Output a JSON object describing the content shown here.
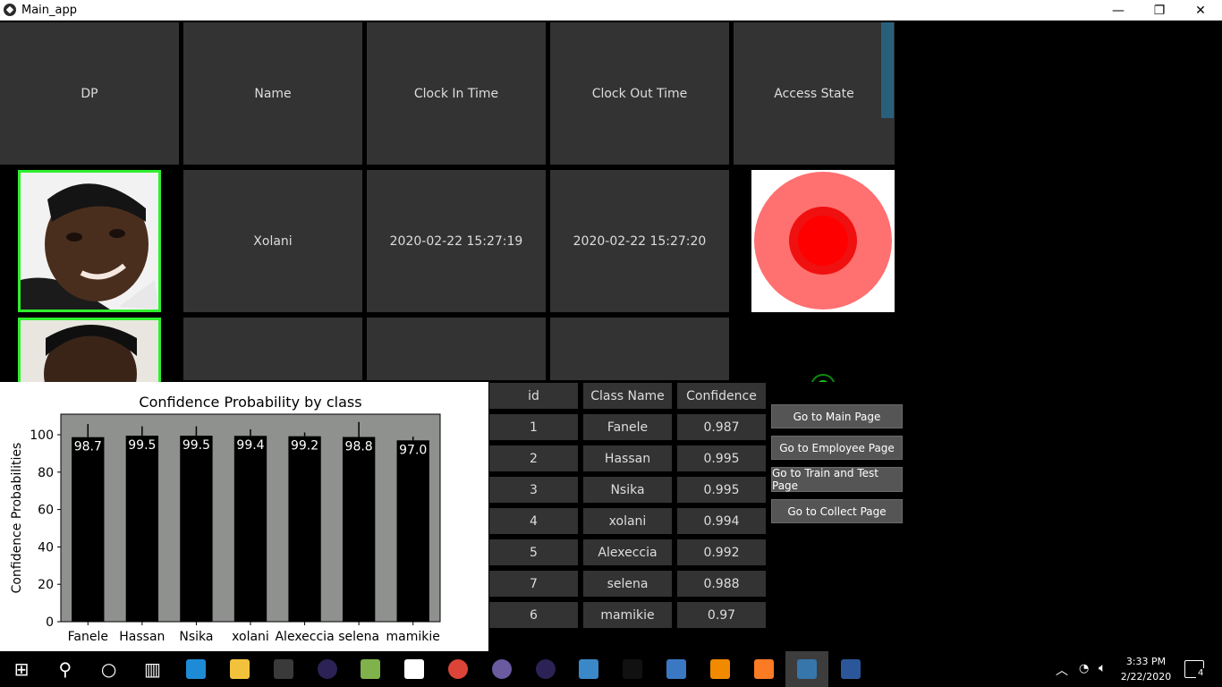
{
  "window": {
    "title": "Main_app",
    "minimize": "—",
    "restore": "❐",
    "close": "✕"
  },
  "attendance": {
    "headers": [
      "DP",
      "Name",
      "Clock In Time",
      "Clock Out Time",
      "Access State"
    ],
    "rows": [
      {
        "name": "Xolani",
        "clock_in": "2020-02-22 15:27:19",
        "clock_out": "2020-02-22 15:27:20",
        "access_state": "denied"
      }
    ]
  },
  "chart_data": {
    "type": "bar",
    "title": "Confidence Probability by class",
    "xlabel": "",
    "ylabel": "Confidence Probabilities",
    "categories": [
      "Fanele",
      "Hassan",
      "Nsika",
      "xolani",
      "Alexeccia",
      "selena",
      "mamikie"
    ],
    "values": [
      98.7,
      99.5,
      99.5,
      99.4,
      99.2,
      98.8,
      97.0
    ],
    "value_labels": [
      "98.7",
      "99.5",
      "99.5",
      "99.4",
      "99.2",
      "98.8",
      "97.0"
    ],
    "error": [
      7,
      5,
      5,
      3.5,
      2,
      8,
      2
    ],
    "ylim": [
      0,
      111
    ],
    "yticks": [
      0,
      20,
      40,
      60,
      80,
      100
    ],
    "bar_color": "#000000",
    "axes_bg": "#8f918f",
    "grid": false
  },
  "results_table": {
    "headers": [
      "id",
      "Class Name",
      "Confidence"
    ],
    "rows": [
      {
        "id": "1",
        "class_name": "Fanele",
        "confidence": "0.987"
      },
      {
        "id": "2",
        "class_name": "Hassan",
        "confidence": "0.995"
      },
      {
        "id": "3",
        "class_name": "Nsika",
        "confidence": "0.995"
      },
      {
        "id": "4",
        "class_name": "xolani",
        "confidence": "0.994"
      },
      {
        "id": "5",
        "class_name": "Alexeccia",
        "confidence": "0.992"
      },
      {
        "id": "7",
        "class_name": "selena",
        "confidence": "0.988"
      },
      {
        "id": "6",
        "class_name": "mamikie",
        "confidence": "0.97"
      }
    ]
  },
  "nav": {
    "main": "Go to Main Page",
    "employee": "Go to Employee Page",
    "train": "Go to Train and Test Page",
    "collect": "Go to Collect Page"
  },
  "taskbar": {
    "time": "3:33 PM",
    "date": "2/22/2020",
    "notifications": "4",
    "icons": [
      "windows-start-icon",
      "search-icon",
      "cortana-icon",
      "task-view-icon",
      "edge-icon",
      "file-explorer-icon",
      "store-icon",
      "eclipse-icon",
      "notepad-icon",
      "mail-icon",
      "chrome-icon",
      "media-icon",
      "eclipse-icon-2",
      "control-panel-icon",
      "terminal-icon",
      "virtualbox-icon",
      "vlc-icon",
      "xampp-icon",
      "python-icon",
      "word-icon"
    ]
  },
  "colors": {
    "accent_green": "#2ef02e",
    "state_red": "#ff0000",
    "state_ring": "#ff7070"
  }
}
